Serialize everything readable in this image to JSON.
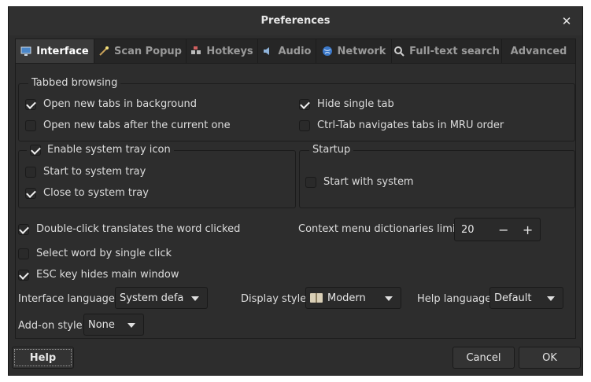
{
  "window": {
    "title": "Preferences"
  },
  "tabs": [
    {
      "label": "Interface",
      "active": true,
      "icon": "monitor-icon"
    },
    {
      "label": "Scan Popup",
      "active": false,
      "icon": "wand-icon"
    },
    {
      "label": "Hotkeys",
      "active": false,
      "icon": "keys-icon"
    },
    {
      "label": "Audio",
      "active": false,
      "icon": "speaker-icon"
    },
    {
      "label": "Network",
      "active": false,
      "icon": "globe-icon"
    },
    {
      "label": "Full-text search",
      "active": false,
      "icon": "magnifier-icon"
    },
    {
      "label": "Advanced",
      "active": false,
      "icon": ""
    }
  ],
  "tabbed_browsing": {
    "title": "Tabbed browsing",
    "open_in_background": {
      "label": "Open new tabs in background",
      "checked": true
    },
    "open_after_current": {
      "label": "Open new tabs after the current one",
      "checked": false
    },
    "hide_single_tab": {
      "label": "Hide single tab",
      "checked": true
    },
    "ctrl_tab_mru": {
      "label": "Ctrl-Tab navigates tabs in MRU order",
      "checked": false
    }
  },
  "system_tray": {
    "title": "Enable system tray icon",
    "enabled": true,
    "start_to_tray": {
      "label": "Start to system tray",
      "checked": false
    },
    "close_to_tray": {
      "label": "Close to system tray",
      "checked": true
    }
  },
  "startup": {
    "title": "Startup",
    "start_with_system": {
      "label": "Start with system",
      "checked": false
    }
  },
  "options": {
    "double_click": {
      "label": "Double-click translates the word clicked",
      "checked": true
    },
    "single_click": {
      "label": "Select word by single click",
      "checked": false
    },
    "esc_hides": {
      "label": "ESC key hides main window",
      "checked": true
    }
  },
  "context_menu_limit": {
    "label": "Context menu dictionaries limit:",
    "value": "20",
    "minus": "−",
    "plus": "+"
  },
  "interface_language": {
    "label": "Interface language:",
    "value": "System defau"
  },
  "display_style": {
    "label": "Display style:",
    "value": "Modern"
  },
  "help_language": {
    "label": "Help language",
    "value": "Default"
  },
  "addon_style": {
    "label": "Add-on style:",
    "value": "None"
  },
  "buttons": {
    "help": "Help",
    "cancel": "Cancel",
    "ok": "OK"
  },
  "colors": {
    "background": "#2d2d2d",
    "text": "#dcdcdc",
    "border": "#1c1c1c",
    "active_tab": "#3a3a3a"
  }
}
